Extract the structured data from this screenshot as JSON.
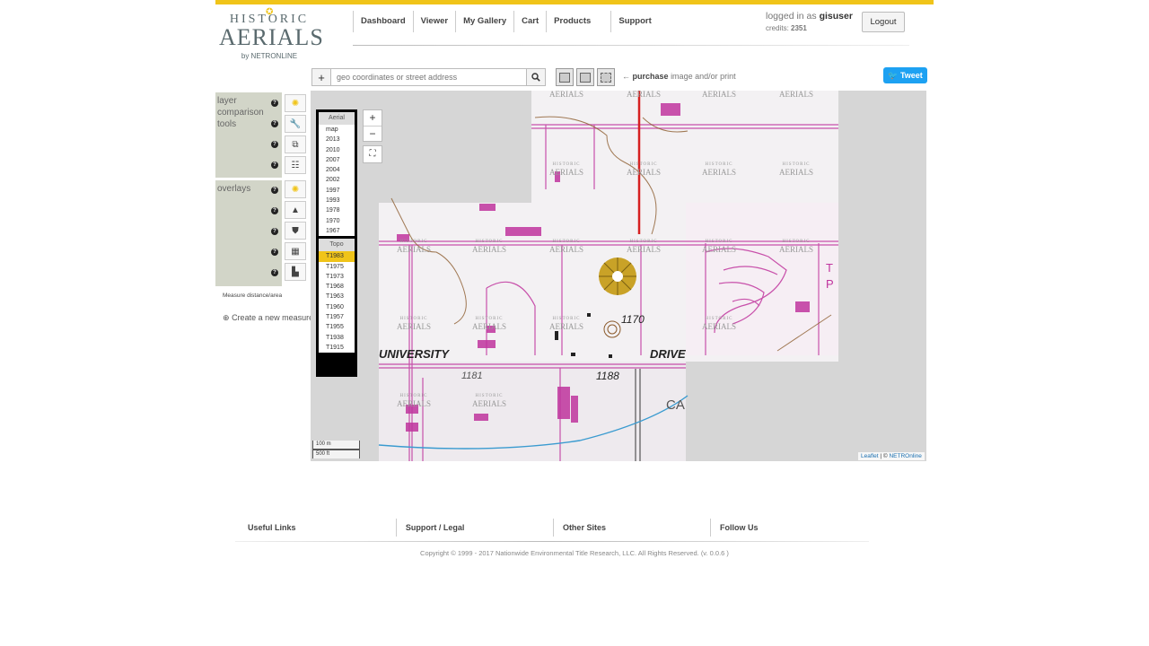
{
  "brand": {
    "line1": "HISTORIC",
    "line2": "AERIALS",
    "line3": "by NETRONLINE"
  },
  "nav": {
    "items": [
      "Dashboard",
      "Viewer",
      "My Gallery",
      "Cart",
      "Products",
      "Support"
    ]
  },
  "user": {
    "logged_prefix": "logged in as",
    "username": "gisuser",
    "credits_label": "credits:",
    "credits": "2351",
    "logout_label": "Logout"
  },
  "search": {
    "placeholder": "geo coordinates or street address",
    "purchase_bold": "purchase",
    "purchase_text": "image and/or print",
    "arrow": "←"
  },
  "tweet_label": "Tweet",
  "sidebar": {
    "tools_label": "layer comparison tools",
    "overlays_label": "overlays",
    "measure_label": "Measure distance/area",
    "create_label": "Create a new measurement"
  },
  "layers": {
    "aerial_tab": "Aerial",
    "aerial_years": [
      "map",
      "2013",
      "2010",
      "2007",
      "2004",
      "2002",
      "1997",
      "1993",
      "1978",
      "1970",
      "1967"
    ],
    "topo_tab": "Topo",
    "topo_years": [
      "T1983",
      "T1975",
      "T1973",
      "T1968",
      "T1963",
      "T1960",
      "T1957",
      "T1955",
      "T1938",
      "T1915"
    ],
    "selected_topo": "T1983"
  },
  "map": {
    "labels": [
      "UNIVERSITY",
      "DRIVE",
      "1170",
      "1188",
      "1181",
      "CA",
      "T",
      "P"
    ],
    "watermark_top": "HISTORIC",
    "watermark_bottom": "AERIALS",
    "zoom_in": "+",
    "zoom_out": "−",
    "scale_metric": "100 m",
    "scale_imperial": "500 ft",
    "attribution_leaflet": "Leaflet",
    "attribution_sep": " | © ",
    "attribution_owner": "NETROnline"
  },
  "footer": {
    "cols": [
      "Useful Links",
      "Support / Legal",
      "Other Sites",
      "Follow Us"
    ],
    "copyright": "Copyright © 1999 - 2017 Nationwide Environmental Title Research, LLC. All Rights Reserved. (v. 0.0.6 )"
  },
  "colors": {
    "accent": "#f0c419",
    "sidebar_bg": "#d2d5c8",
    "tweet": "#1da1f2",
    "topo_magenta": "#c0359e",
    "topo_red": "#d62020"
  }
}
